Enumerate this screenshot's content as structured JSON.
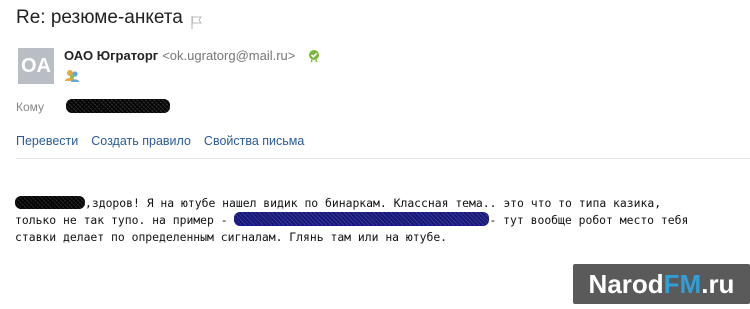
{
  "message": {
    "subject": "Re: резюме-анкета",
    "sender": {
      "avatar_initials": "OA",
      "name": "ОАО Юграторг",
      "email": "<ok.ugratorg@mail.ru>"
    },
    "to_label": "Кому",
    "actions": [
      "Перевести",
      "Создать правило",
      "Свойства письма"
    ],
    "body": {
      "line1_after": ",здоров! Я на ютубе нашел видик по бинаркам. Классная тема.. это что то типа казика,",
      "line2_before": "только не так тупо. на пример - ",
      "line2_after": "- тут вообще робот место тебя",
      "line3": "ставки делает по определенным сигналам. Глянь там или на ютубе."
    }
  },
  "watermark": {
    "part1": "Narod",
    "part2": "FM",
    "part3": ".ru"
  },
  "icons": {
    "flag": "flag-icon",
    "verified": "verified-badge-icon",
    "people": "contacts-icon"
  },
  "colors": {
    "link": "#2a5a9c",
    "avatar_bg": "#b8bec4",
    "watermark_bg": "#5a5a5a",
    "watermark_accent": "#2f9fd8",
    "verified_green": "#7ab83a"
  }
}
